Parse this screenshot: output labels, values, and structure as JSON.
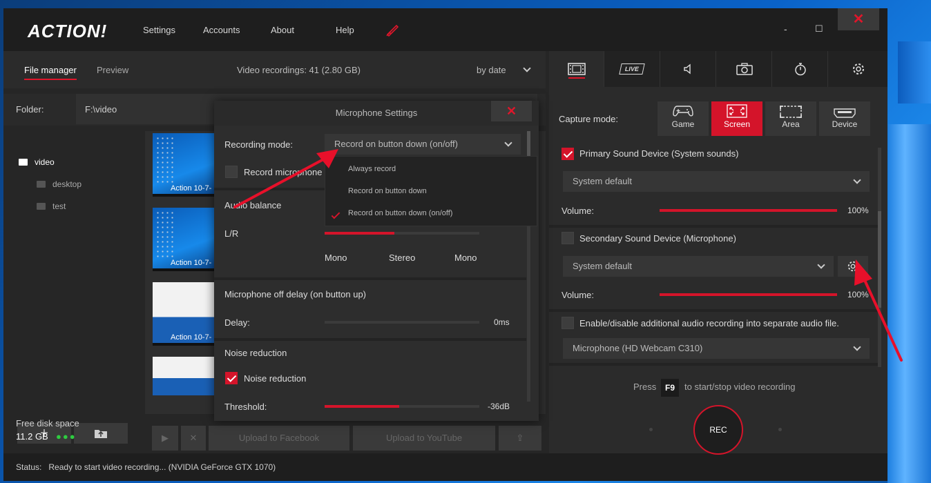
{
  "app": {
    "logo": "ACTION!",
    "menu": [
      "Settings",
      "Accounts",
      "About",
      "Help"
    ],
    "minimize": "-",
    "maximize": "☐",
    "close": "✕"
  },
  "left": {
    "tabs": [
      "File manager",
      "Preview"
    ],
    "video_count": "Video recordings: 41 (2.80 GB)",
    "sort": "by date",
    "folder_label": "Folder:",
    "folder_value": "F:\\video",
    "tree": [
      {
        "label": "video",
        "level": 0
      },
      {
        "label": "desktop",
        "level": 1
      },
      {
        "label": "test",
        "level": 1
      }
    ],
    "thumb_caption": "Action 10-7-",
    "add": "+",
    "free_disk_label": "Free disk space",
    "free_disk_value": "11.2 GB",
    "dots": "●●●",
    "upload_facebook": "Upload to Facebook",
    "upload_youtube": "Upload to YouTube"
  },
  "status": {
    "label": "Status:",
    "text": "Ready to start video recording... (NVIDIA GeForce GTX 1070)"
  },
  "right": {
    "live_tab": "LIVE",
    "capture_label": "Capture mode:",
    "modes": [
      "Game",
      "Screen",
      "Area",
      "Device"
    ],
    "primary_label": "Primary Sound Device (System sounds)",
    "primary_device": "System default",
    "volume_label": "Volume:",
    "primary_volume": "100%",
    "primary_volume_level": 1.0,
    "secondary_label": "Secondary Sound Device (Microphone)",
    "secondary_device": "System default",
    "secondary_volume": "100%",
    "secondary_volume_level": 1.0,
    "additional_label": "Enable/disable additional audio recording into separate audio file.",
    "additional_device": "Microphone (HD Webcam C310)",
    "press": "Press",
    "key": "F9",
    "press_suffix": "to start/stop video recording",
    "rec": "REC"
  },
  "modal": {
    "title": "Microphone Settings",
    "close": "✕",
    "recording_mode_label": "Recording mode:",
    "recording_mode_value": "Record on button down (on/off)",
    "record_microphone": "Record microphone",
    "audio_balance": "Audio balance",
    "lr": "L/R",
    "balance_level": 0.45,
    "mono_left": "Mono",
    "stereo": "Stereo",
    "mono_right": "Mono",
    "off_delay_title": "Microphone off delay (on button up)",
    "delay_label": "Delay:",
    "delay_value": "0ms",
    "noise_title": "Noise reduction",
    "noise_check": "Noise reduction",
    "threshold_label": "Threshold:",
    "threshold_value": "-36dB",
    "threshold_level": 0.48,
    "options": [
      "Always record",
      "Record on button down",
      "Record on button down (on/off)"
    ]
  },
  "colors": {
    "accent": "#d4142a",
    "annotation_arrow": "#e8102a"
  }
}
